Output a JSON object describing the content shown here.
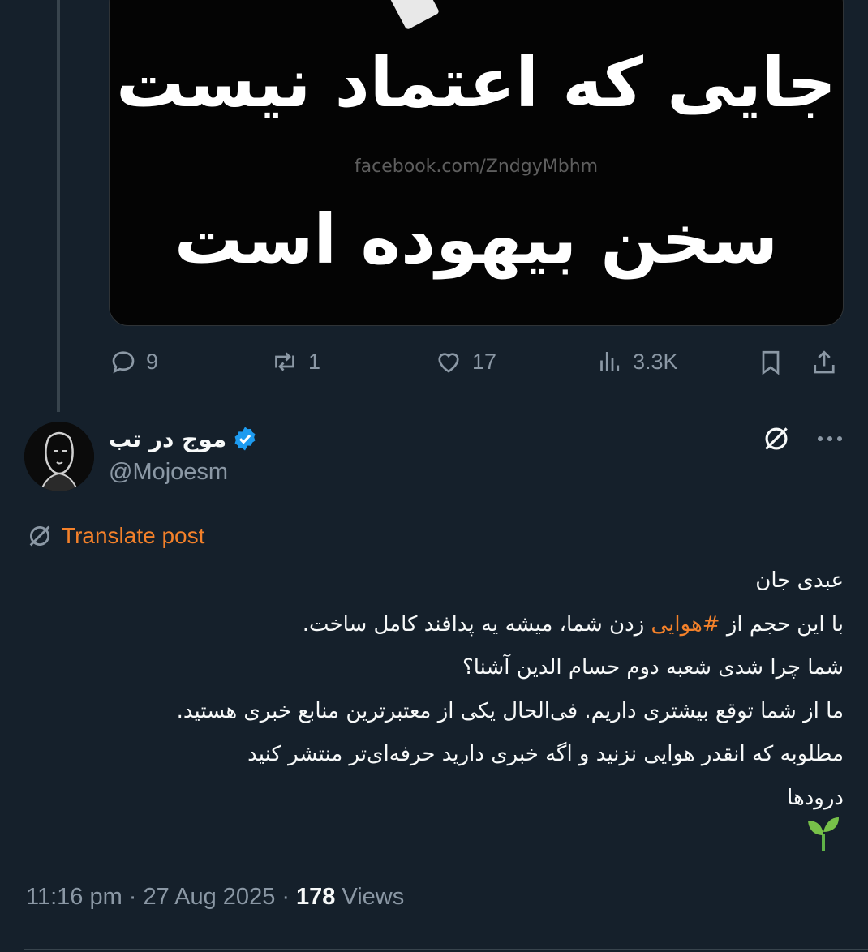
{
  "media": {
    "line1": "جایی که اعتماد نیست",
    "watermark": "facebook.com/ZndgyMbhm",
    "line2": "سخن بیهوده است"
  },
  "prev_post_actions": {
    "replies": "9",
    "reposts": "1",
    "likes": "17",
    "views": "3.3K"
  },
  "author": {
    "display_name": "موج در تب",
    "handle": "@Mojoesm",
    "verified": true
  },
  "translate_label": "Translate post",
  "body": {
    "line1": "عبدی جان",
    "line2_before": "با این حجم از ",
    "hashtag": "#هوایی",
    "line2_after": " زدن شما، میشه یه پدافند کامل ساخت.",
    "line3": "شما چرا شدی شعبه دوم حسام الدین آشنا؟",
    "line4": "ما از شما توقع بیشتری داریم. فی‌الحال یکی از معتبرترین منابع خبری هستید.",
    "line5": "مطلوبه که انقدر هوایی نزنید و اگه خبری دارید حرفه‌ای‌تر منتشر کنید",
    "line6": "درودها",
    "emoji": "🌱"
  },
  "meta": {
    "time": "11:16 pm",
    "sep1": "·",
    "date": "27 Aug 2025",
    "sep2": "·",
    "views_count": "178",
    "views_label": "Views"
  },
  "colors": {
    "background": "#15202b",
    "accent": "#f4812a",
    "verified": "#1d9bf0",
    "muted": "#8b98a5"
  }
}
